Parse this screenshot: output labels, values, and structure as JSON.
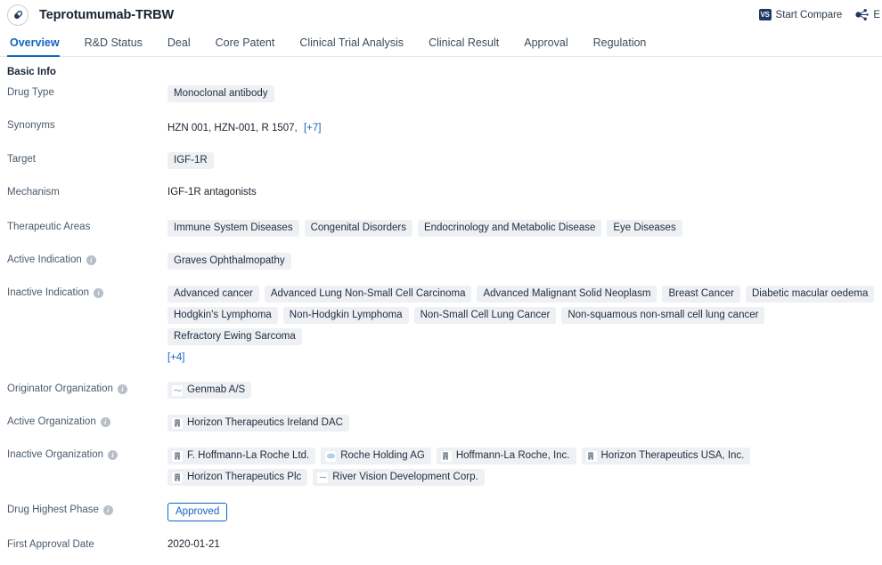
{
  "header": {
    "logo_icon": "capsule-pill-icon",
    "title": "Teprotumumab-TRBW",
    "compare_badge": "VS",
    "compare_label": "Start Compare",
    "share_icon": "share-network-icon",
    "share_label": "E"
  },
  "tabs": [
    {
      "label": "Overview",
      "active": true
    },
    {
      "label": "R&D Status",
      "active": false
    },
    {
      "label": "Deal",
      "active": false
    },
    {
      "label": "Core Patent",
      "active": false
    },
    {
      "label": "Clinical Trial Analysis",
      "active": false
    },
    {
      "label": "Clinical Result",
      "active": false
    },
    {
      "label": "Approval",
      "active": false
    },
    {
      "label": "Regulation",
      "active": false
    }
  ],
  "section": {
    "title": "Basic Info"
  },
  "fields": {
    "drug_type": {
      "label": "Drug Type",
      "tags": [
        "Monoclonal antibody"
      ]
    },
    "synonyms": {
      "label": "Synonyms",
      "text": "HZN 001,  HZN-001,  R 1507,",
      "more": "[+7]"
    },
    "target": {
      "label": "Target",
      "tags": [
        "IGF-1R"
      ]
    },
    "mechanism": {
      "label": "Mechanism",
      "text": "IGF-1R antagonists"
    },
    "therapeutic_areas": {
      "label": "Therapeutic Areas",
      "tags": [
        "Immune System Diseases",
        "Congenital Disorders",
        "Endocrinology and Metabolic Disease",
        "Eye Diseases"
      ]
    },
    "active_indication": {
      "label": "Active Indication",
      "info": true,
      "tags": [
        "Graves Ophthalmopathy"
      ]
    },
    "inactive_indication": {
      "label": "Inactive Indication",
      "info": true,
      "tags": [
        "Advanced cancer",
        "Advanced Lung Non-Small Cell Carcinoma",
        "Advanced Malignant Solid Neoplasm",
        "Breast Cancer",
        "Diabetic macular oedema",
        "Hodgkin's Lymphoma",
        "Non-Hodgkin Lymphoma",
        "Non-Small Cell Lung Cancer",
        "Non-squamous non-small cell lung cancer",
        "Refractory Ewing Sarcoma"
      ],
      "more": "[+4]"
    },
    "originator_organization": {
      "label": "Originator Organization",
      "info": true,
      "orgs": [
        {
          "name": "Genmab A/S",
          "icon": "company-logo-icon"
        }
      ]
    },
    "active_organization": {
      "label": "Active Organization",
      "info": true,
      "orgs": [
        {
          "name": "Horizon Therapeutics Ireland DAC",
          "icon": "company-building-icon"
        }
      ]
    },
    "inactive_organization": {
      "label": "Inactive Organization",
      "info": true,
      "orgs": [
        {
          "name": "F. Hoffmann-La Roche Ltd.",
          "icon": "company-building-icon"
        },
        {
          "name": "Roche Holding AG",
          "icon": "company-logo-icon"
        },
        {
          "name": "Hoffmann-La Roche, Inc.",
          "icon": "company-building-icon"
        },
        {
          "name": "Horizon Therapeutics USA, Inc.",
          "icon": "company-building-icon"
        },
        {
          "name": "Horizon Therapeutics Plc",
          "icon": "company-building-icon"
        },
        {
          "name": "River Vision Development Corp.",
          "icon": "company-logo-icon"
        }
      ]
    },
    "drug_highest_phase": {
      "label": "Drug Highest Phase",
      "info": true,
      "badge": "Approved"
    },
    "first_approval_date": {
      "label": "First Approval Date",
      "text": "2020-01-21"
    }
  },
  "colors": {
    "accent": "#1065c0",
    "tag_bg": "#eef0f3",
    "label": "#4a5a6b",
    "text": "#182330"
  }
}
